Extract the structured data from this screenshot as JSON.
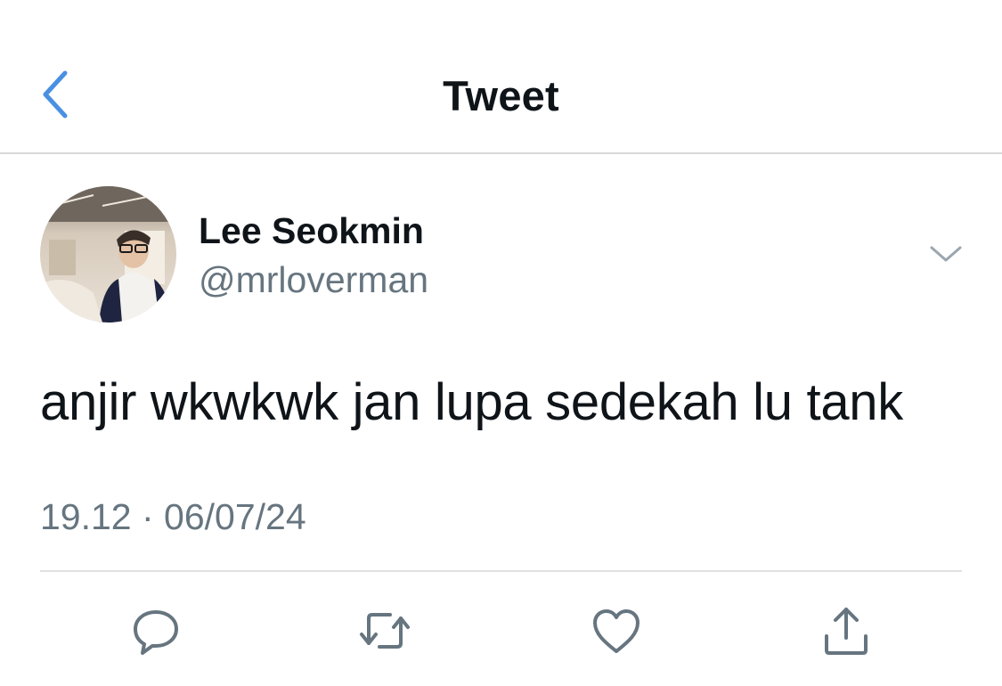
{
  "header": {
    "title": "Tweet",
    "back_icon": "chevron-left-icon"
  },
  "author": {
    "display_name": "Lee Seokmin",
    "handle": "@mrloverman",
    "more_icon": "chevron-down-icon"
  },
  "tweet": {
    "text": "anjir wkwkwk jan lupa sedekah lu tank",
    "timestamp": "19.12 · 06/07/24"
  },
  "actions": [
    {
      "icon": "reply-icon"
    },
    {
      "icon": "retweet-icon"
    },
    {
      "icon": "like-icon"
    },
    {
      "icon": "share-icon"
    }
  ],
  "colors": {
    "accent": "#1d9bf0",
    "text_primary": "#0f1419",
    "text_secondary": "#66757f",
    "icon": "#66757f",
    "divider": "#e1e1e1"
  }
}
